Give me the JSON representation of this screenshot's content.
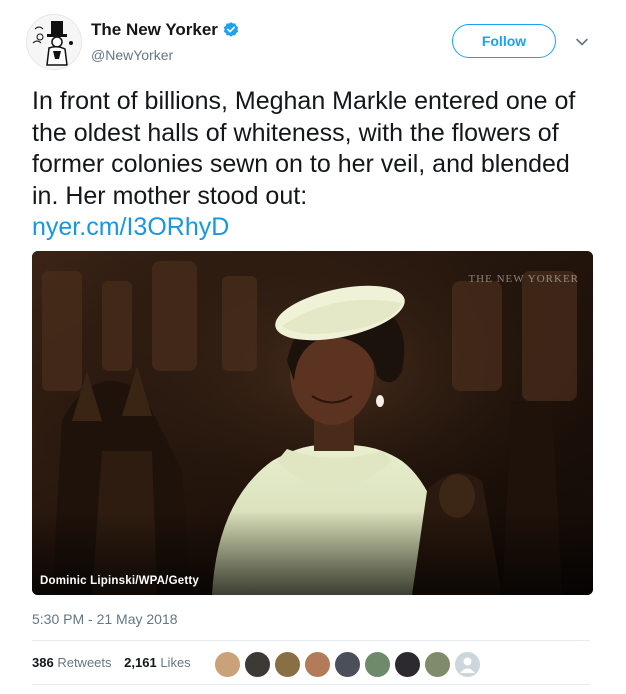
{
  "account": {
    "display_name": "The New Yorker",
    "handle": "@NewYorker",
    "verified_icon": "verified-badge-icon",
    "avatar_icon": "eustace-tilley-avatar"
  },
  "actions": {
    "follow_label": "Follow",
    "menu_icon": "chevron-down-icon"
  },
  "tweet": {
    "text": "In front of billions, Meghan Markle entered one of the oldest halls of whiteness, with the flowers of former colonies sewn on to  her veil, and blended in. Her mother stood out: ",
    "link_text": "nyer.cm/I3ORhyD"
  },
  "media": {
    "photo_credit": "Dominic Lipinski/WPA/Getty",
    "watermark": "THE NEW YORKER"
  },
  "meta": {
    "timestamp": "5:30 PM - 21 May 2018"
  },
  "stats": {
    "retweets_count": "386",
    "retweets_label": "Retweets",
    "likes_count": "2,161",
    "likes_label": "Likes"
  },
  "colors": {
    "accent": "#1da1f2",
    "link": "#1b95e0",
    "secondary_text": "#657786"
  }
}
